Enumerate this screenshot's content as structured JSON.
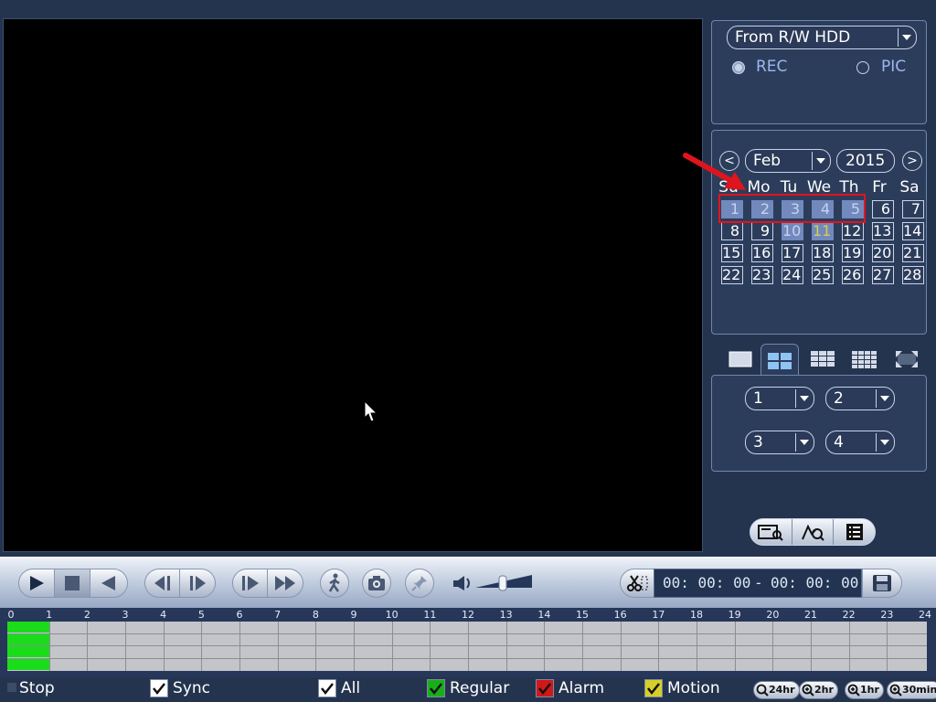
{
  "source": {
    "selected": "From R/W HDD",
    "radio_rec": "REC",
    "radio_pic": "PIC",
    "selected_mode": "REC"
  },
  "calendar": {
    "prev_label": "<",
    "next_label": ">",
    "month": "Feb",
    "year": "2015",
    "weekdays": [
      "Su",
      "Mo",
      "Tu",
      "We",
      "Th",
      "Fr",
      "Sa"
    ],
    "days": [
      "1",
      "2",
      "3",
      "4",
      "5",
      "6",
      "7",
      "8",
      "9",
      "10",
      "11",
      "12",
      "13",
      "14",
      "15",
      "16",
      "17",
      "18",
      "19",
      "20",
      "21",
      "22",
      "23",
      "24",
      "25",
      "26",
      "27",
      "28"
    ],
    "days_with_records": [
      "1",
      "2",
      "3",
      "4",
      "5",
      "10"
    ],
    "today": "11"
  },
  "channels": {
    "ch1": "1",
    "ch2": "2",
    "ch3": "3",
    "ch4": "4"
  },
  "time_range": {
    "start": "00: 00: 00",
    "separator": "-",
    "end": "00: 00: 00"
  },
  "timeline": {
    "ticks": [
      "0",
      "1",
      "2",
      "3",
      "4",
      "5",
      "6",
      "7",
      "8",
      "9",
      "10",
      "11",
      "12",
      "13",
      "14",
      "15",
      "16",
      "17",
      "18",
      "19",
      "20",
      "21",
      "22",
      "23",
      "24"
    ],
    "recorded_hours": 1
  },
  "filters": {
    "stop": "Stop",
    "sync": "Sync",
    "all": "All",
    "regular": "Regular",
    "alarm": "Alarm",
    "motion": "Motion"
  },
  "zoom": {
    "z24": "24hr",
    "z2": "2hr",
    "z1": "1hr",
    "z30": "30min"
  },
  "colors": {
    "record_green": "#1bdc1b",
    "regular": "#18b018",
    "alarm": "#d01818",
    "motion": "#d6cf2a",
    "highlight": "#e0141c"
  }
}
